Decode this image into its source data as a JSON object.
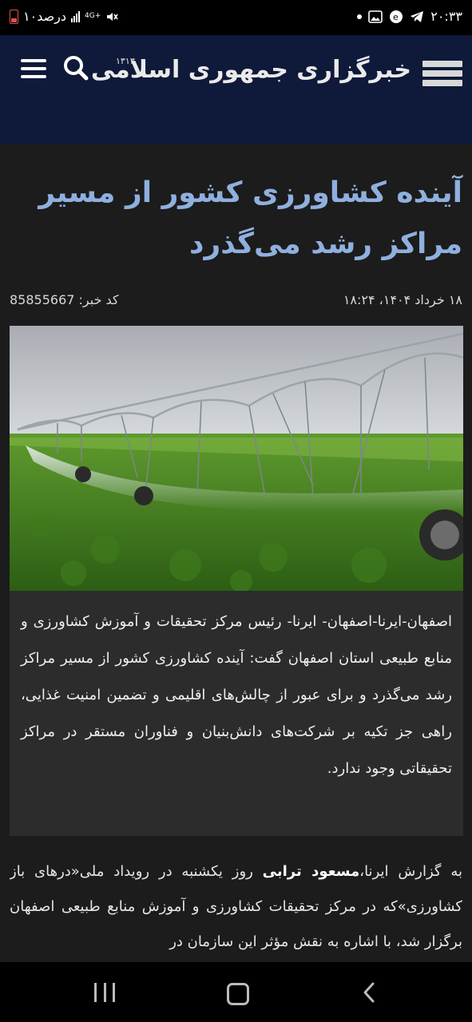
{
  "status_bar": {
    "time": "۲۰:۳۳",
    "battery": "۱۰درصد",
    "network": "4G+"
  },
  "header": {
    "logo_text": "خبرگزاری جمهوری اسلامی",
    "logo_year": "۱۳۱۳",
    "icons": [
      "hamburger-menu-icon",
      "search-icon",
      "irna-logo-icon"
    ]
  },
  "article": {
    "title": "آینده کشاورزی کشور از مسیر مراکز رشد می‌گذرد",
    "date": "۱۸ خرداد ۱۴۰۴، ۱۸:۲۴",
    "code_label": "کد خبر:",
    "code_value": "85855667",
    "summary": "اصفهان-ایرنا-اصفهان- ایرنا- رئیس مرکز تحقیقات و آموزش کشاورزی و منابع طبیعی استان اصفهان گفت: آینده کشاورزی کشور از مسیر مراکز رشد می‌گذرد و برای عبور از چالش‌های اقلیمی و تضمین امنیت غذایی، راهی جز تکیه بر شرکت‌های دانش‌بنیان و فناوران مستقر در مراکز تحقیقاتی وجود ندارد.",
    "body_intro": "به گزارش ایرنا،",
    "body_name": "مسعود ترابی",
    "body_rest": " روز یکشنبه در رویداد ملی«درهای باز کشاورزی»که در مرکز تحقیقات کشاورزی و آموزش منابع طبیعی اصفهان برگزار شد، با اشاره به نقش مؤثر این سازمان در"
  },
  "colors": {
    "header_bg": "#0f1a3a",
    "title": "#8fb0df",
    "page_bg": "#1c1c1c",
    "summary_bg": "#2c2c2c"
  }
}
